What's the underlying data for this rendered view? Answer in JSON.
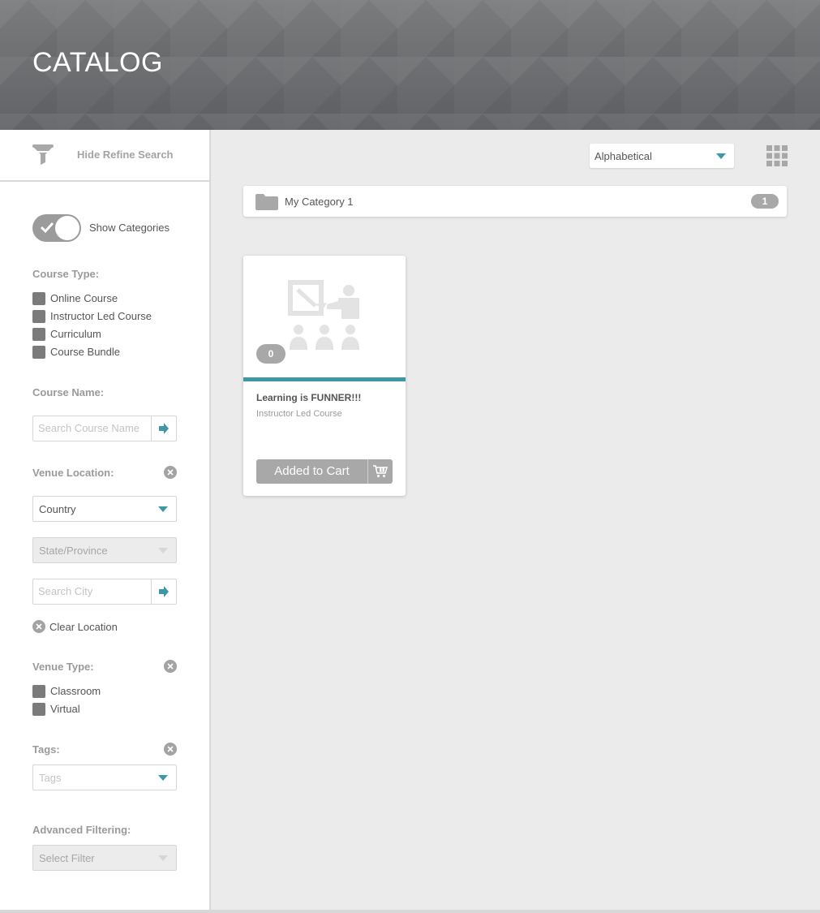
{
  "header": {
    "title": "CATALOG"
  },
  "sidebar": {
    "refine_label": "Hide Refine Search",
    "show_categories_label": "Show Categories",
    "course_type": {
      "title": "Course Type:",
      "options": [
        "Online Course",
        "Instructor Led Course",
        "Curriculum",
        "Course Bundle"
      ]
    },
    "course_name": {
      "title": "Course Name:",
      "placeholder": "Search Course Name"
    },
    "venue_location": {
      "title": "Venue Location:",
      "country": "Country",
      "state": "State/Province",
      "city_placeholder": "Search City",
      "clear_label": "Clear Location"
    },
    "venue_type": {
      "title": "Venue Type:",
      "options": [
        "Classroom",
        "Virtual"
      ]
    },
    "tags": {
      "title": "Tags:",
      "placeholder": "Tags"
    },
    "advanced": {
      "title": "Advanced Filtering:",
      "placeholder": "Select Filter"
    }
  },
  "main": {
    "sort": {
      "selected": "Alphabetical"
    },
    "category": {
      "name": "My Category 1",
      "count": "1"
    },
    "course": {
      "badge": "0",
      "title": "Learning is FUNNER!!!",
      "type": "Instructor Led Course",
      "button_label": "Added to Cart"
    }
  },
  "colors": {
    "accent": "#3d97a5",
    "header_bg": "#6d6e70",
    "badge": "#a8a8a8"
  }
}
